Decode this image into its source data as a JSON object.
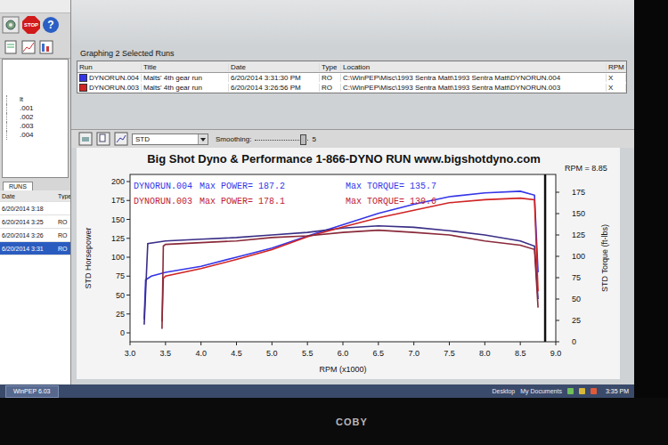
{
  "window": {
    "title": "Graphing 2 Selected Runs"
  },
  "toolbar": [
    {
      "label": "STOP",
      "kind": "stop"
    },
    {
      "label": "?",
      "kind": "help"
    }
  ],
  "tree": {
    "items": [
      {
        "label": "lt",
        "selected": false
      },
      {
        "label": ".001",
        "selected": false
      },
      {
        "label": ".002",
        "selected": false
      },
      {
        "label": ".003",
        "selected": false
      },
      {
        "label": ".004",
        "selected": false
      }
    ]
  },
  "runs_panel": {
    "tabs": [
      {
        "label": "RUNS",
        "selected": true
      }
    ],
    "columns": [
      "Date",
      "Type"
    ],
    "rows": [
      {
        "date": "6/20/2014 3:18",
        "type": "",
        "selected": false
      },
      {
        "date": "6/20/2014 3:25",
        "type": "RO",
        "selected": false
      },
      {
        "date": "6/20/2014 3:26",
        "type": "RO",
        "selected": false
      },
      {
        "date": "6/20/2014 3:31",
        "type": "RO",
        "selected": true
      }
    ]
  },
  "runs_table": {
    "columns": [
      "Run",
      "Title",
      "Date",
      "Type",
      "Location",
      "RPM"
    ],
    "rows": [
      {
        "run": "DYNORUN.004",
        "title": "Malts' 4th gear run",
        "date": "6/20/2014 3:31:30 PM",
        "type": "RO",
        "location": "C:\\WinPEP\\Misc\\1993 Sentra Matt\\1993 Sentra Matt\\DYNORUN.004",
        "rpm": "X",
        "color": "#3535e8"
      },
      {
        "run": "DYNORUN.003",
        "title": "Malts' 4th gear run",
        "date": "6/20/2014 3:26:56 PM",
        "type": "RO",
        "location": "C:\\WinPEP\\Misc\\1993 Sentra Matt\\1993 Sentra Matt\\DYNORUN.003",
        "rpm": "X",
        "color": "#d02424"
      }
    ]
  },
  "chart_toolbar": {
    "mode": "STD",
    "smoothing_label": "Smoothing:",
    "smoothing_value": "5",
    "smoothing_level": 0.9
  },
  "chart": {
    "title": "Big Shot Dyno & Performance 1-866-DYNO RUN www.bigshotdyno.com",
    "cursor_label": "RPM = 8.85",
    "cursor_rpm": 8.85,
    "x_axis": {
      "title": "RPM (x1000)",
      "ticks": [
        "3.0",
        "3.5",
        "4.0",
        "4.5",
        "5.0",
        "5.5",
        "6.0",
        "6.5",
        "7.0",
        "7.5",
        "8.0",
        "8.5",
        "9.0"
      ]
    },
    "y_axis_left": {
      "title": "STD Horsepower",
      "ticks": [
        "0",
        "25",
        "50",
        "75",
        "100",
        "125",
        "150",
        "175",
        "200"
      ]
    },
    "y_axis_right": {
      "title": "STD Torque (ft-lbs)",
      "ticks": [
        "0",
        "25",
        "50",
        "75",
        "100",
        "125",
        "150",
        "175"
      ]
    },
    "legend": [
      {
        "run": "DYNORUN.004",
        "power": "Max POWER= 187.2",
        "torque": "Max TORQUE= 135.7",
        "color": "#3535e8"
      },
      {
        "run": "DYNORUN.003",
        "power": "Max POWER= 178.1",
        "torque": "Max TORQUE= 130.6",
        "color": "#c02030"
      }
    ],
    "series": [
      {
        "name": "DYNORUN.004 power",
        "axis": "left",
        "color": "#3535e8",
        "rpm": [
          3.2,
          3.22,
          3.3,
          3.5,
          4.0,
          4.5,
          5.0,
          5.5,
          6.0,
          6.5,
          7.0,
          7.5,
          8.0,
          8.5,
          8.7,
          8.75
        ],
        "values": [
          18,
          70,
          75,
          80,
          88,
          100,
          112,
          128,
          143,
          158,
          170,
          180,
          185,
          187.2,
          182,
          80
        ]
      },
      {
        "name": "DYNORUN.004 torque",
        "axis": "right",
        "color": "#3a2e86",
        "rpm": [
          3.2,
          3.25,
          3.5,
          4.0,
          4.5,
          5.0,
          5.5,
          6.0,
          6.5,
          7.0,
          7.5,
          8.0,
          8.5,
          8.7,
          8.75
        ],
        "values": [
          20,
          115,
          118,
          120,
          122,
          125,
          128,
          133,
          135.7,
          134,
          130,
          125,
          118,
          112,
          50
        ]
      },
      {
        "name": "DYNORUN.003 power",
        "axis": "left",
        "color": "#d02424",
        "rpm": [
          3.45,
          3.47,
          3.5,
          4.0,
          4.5,
          5.0,
          5.5,
          6.0,
          6.5,
          7.0,
          7.5,
          8.0,
          8.5,
          8.7,
          8.75
        ],
        "values": [
          15,
          72,
          75,
          85,
          97,
          110,
          127,
          140,
          152,
          162,
          172,
          176,
          178.1,
          176,
          55
        ]
      },
      {
        "name": "DYNORUN.003 torque",
        "axis": "right",
        "color": "#8a2a3a",
        "rpm": [
          3.45,
          3.47,
          3.5,
          4.0,
          4.5,
          5.0,
          5.5,
          6.0,
          6.5,
          7.0,
          7.5,
          8.0,
          8.5,
          8.7,
          8.75
        ],
        "values": [
          15,
          112,
          114,
          116,
          118,
          122,
          124,
          128,
          130.6,
          128,
          125,
          118,
          113,
          108,
          40
        ]
      }
    ]
  },
  "taskbar": {
    "start": "WinPEP 6.03",
    "links": [
      "Desktop",
      "My Documents"
    ],
    "time": "3:35 PM"
  },
  "monitor": {
    "brand": "COBY"
  }
}
